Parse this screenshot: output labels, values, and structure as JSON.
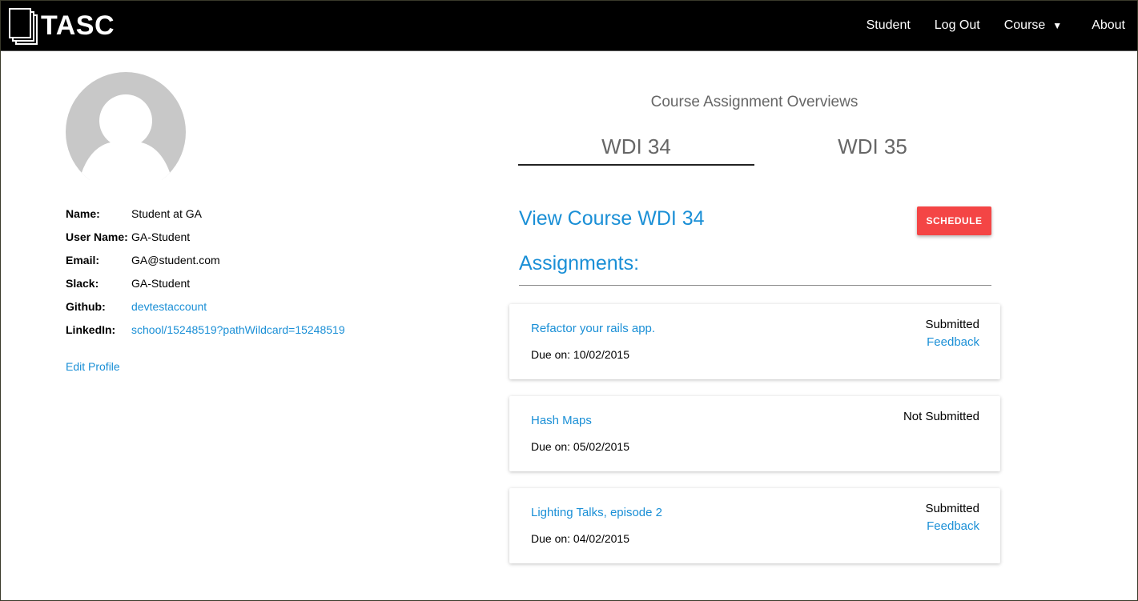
{
  "nav": {
    "brand": "TASC",
    "items": [
      "Student",
      "Log Out",
      "Course"
    ],
    "about": "About"
  },
  "profile": {
    "fields": [
      {
        "label": "Name:",
        "value": "Student at GA",
        "link": false
      },
      {
        "label": "User Name:",
        "value": "GA-Student",
        "link": false
      },
      {
        "label": "Email:",
        "value": "GA@student.com",
        "link": false
      },
      {
        "label": "Slack:",
        "value": "GA-Student",
        "link": false
      },
      {
        "label": "Github:",
        "value": "devtestaccount",
        "link": true
      },
      {
        "label": "LinkedIn:",
        "value": "school/15248519?pathWildcard=15248519",
        "link": true
      }
    ],
    "edit_label": "Edit Profile"
  },
  "overview": {
    "title": "Course Assignment Overviews",
    "tabs": [
      {
        "label": "WDI 34",
        "active": true
      },
      {
        "label": "WDI 35",
        "active": false
      }
    ],
    "view_course": "View Course WDI 34",
    "schedule_label": "SCHEDULE",
    "assignments_heading": "Assignments:"
  },
  "assignments": [
    {
      "title": "Refactor your rails app.",
      "due": "Due on: 10/02/2015",
      "status": "Submitted",
      "feedback": "Feedback"
    },
    {
      "title": "Hash Maps",
      "due": "Due on: 05/02/2015",
      "status": "Not Submitted",
      "feedback": ""
    },
    {
      "title": "Lighting Talks, episode 2",
      "due": "Due on: 04/02/2015",
      "status": "Submitted",
      "feedback": "Feedback"
    }
  ],
  "colors": {
    "navbar": "#000000",
    "link": "#1a8fd6",
    "schedule_button": "#f44545",
    "avatar": "#c8c8c8"
  },
  "icons": [
    "document-stack-icon",
    "caret-down-icon",
    "user-avatar-icon"
  ]
}
